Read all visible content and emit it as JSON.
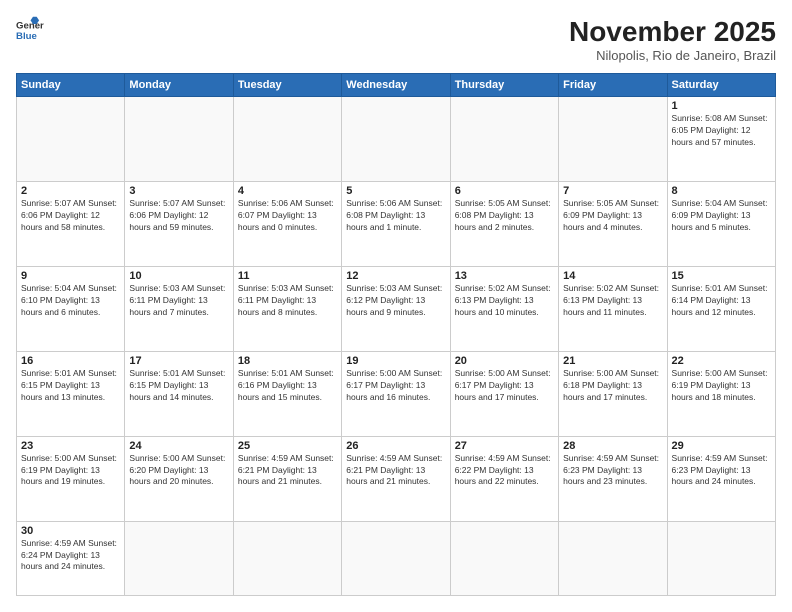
{
  "header": {
    "logo_general": "General",
    "logo_blue": "Blue",
    "month_title": "November 2025",
    "location": "Nilopolis, Rio de Janeiro, Brazil"
  },
  "weekdays": [
    "Sunday",
    "Monday",
    "Tuesday",
    "Wednesday",
    "Thursday",
    "Friday",
    "Saturday"
  ],
  "weeks": [
    [
      {
        "day": null,
        "info": null
      },
      {
        "day": null,
        "info": null
      },
      {
        "day": null,
        "info": null
      },
      {
        "day": null,
        "info": null
      },
      {
        "day": null,
        "info": null
      },
      {
        "day": null,
        "info": null
      },
      {
        "day": "1",
        "info": "Sunrise: 5:08 AM\nSunset: 6:05 PM\nDaylight: 12 hours\nand 57 minutes."
      }
    ],
    [
      {
        "day": "2",
        "info": "Sunrise: 5:07 AM\nSunset: 6:06 PM\nDaylight: 12 hours\nand 58 minutes."
      },
      {
        "day": "3",
        "info": "Sunrise: 5:07 AM\nSunset: 6:06 PM\nDaylight: 12 hours\nand 59 minutes."
      },
      {
        "day": "4",
        "info": "Sunrise: 5:06 AM\nSunset: 6:07 PM\nDaylight: 13 hours\nand 0 minutes."
      },
      {
        "day": "5",
        "info": "Sunrise: 5:06 AM\nSunset: 6:08 PM\nDaylight: 13 hours\nand 1 minute."
      },
      {
        "day": "6",
        "info": "Sunrise: 5:05 AM\nSunset: 6:08 PM\nDaylight: 13 hours\nand 2 minutes."
      },
      {
        "day": "7",
        "info": "Sunrise: 5:05 AM\nSunset: 6:09 PM\nDaylight: 13 hours\nand 4 minutes."
      },
      {
        "day": "8",
        "info": "Sunrise: 5:04 AM\nSunset: 6:09 PM\nDaylight: 13 hours\nand 5 minutes."
      }
    ],
    [
      {
        "day": "9",
        "info": "Sunrise: 5:04 AM\nSunset: 6:10 PM\nDaylight: 13 hours\nand 6 minutes."
      },
      {
        "day": "10",
        "info": "Sunrise: 5:03 AM\nSunset: 6:11 PM\nDaylight: 13 hours\nand 7 minutes."
      },
      {
        "day": "11",
        "info": "Sunrise: 5:03 AM\nSunset: 6:11 PM\nDaylight: 13 hours\nand 8 minutes."
      },
      {
        "day": "12",
        "info": "Sunrise: 5:03 AM\nSunset: 6:12 PM\nDaylight: 13 hours\nand 9 minutes."
      },
      {
        "day": "13",
        "info": "Sunrise: 5:02 AM\nSunset: 6:13 PM\nDaylight: 13 hours\nand 10 minutes."
      },
      {
        "day": "14",
        "info": "Sunrise: 5:02 AM\nSunset: 6:13 PM\nDaylight: 13 hours\nand 11 minutes."
      },
      {
        "day": "15",
        "info": "Sunrise: 5:01 AM\nSunset: 6:14 PM\nDaylight: 13 hours\nand 12 minutes."
      }
    ],
    [
      {
        "day": "16",
        "info": "Sunrise: 5:01 AM\nSunset: 6:15 PM\nDaylight: 13 hours\nand 13 minutes."
      },
      {
        "day": "17",
        "info": "Sunrise: 5:01 AM\nSunset: 6:15 PM\nDaylight: 13 hours\nand 14 minutes."
      },
      {
        "day": "18",
        "info": "Sunrise: 5:01 AM\nSunset: 6:16 PM\nDaylight: 13 hours\nand 15 minutes."
      },
      {
        "day": "19",
        "info": "Sunrise: 5:00 AM\nSunset: 6:17 PM\nDaylight: 13 hours\nand 16 minutes."
      },
      {
        "day": "20",
        "info": "Sunrise: 5:00 AM\nSunset: 6:17 PM\nDaylight: 13 hours\nand 17 minutes."
      },
      {
        "day": "21",
        "info": "Sunrise: 5:00 AM\nSunset: 6:18 PM\nDaylight: 13 hours\nand 17 minutes."
      },
      {
        "day": "22",
        "info": "Sunrise: 5:00 AM\nSunset: 6:19 PM\nDaylight: 13 hours\nand 18 minutes."
      }
    ],
    [
      {
        "day": "23",
        "info": "Sunrise: 5:00 AM\nSunset: 6:19 PM\nDaylight: 13 hours\nand 19 minutes."
      },
      {
        "day": "24",
        "info": "Sunrise: 5:00 AM\nSunset: 6:20 PM\nDaylight: 13 hours\nand 20 minutes."
      },
      {
        "day": "25",
        "info": "Sunrise: 4:59 AM\nSunset: 6:21 PM\nDaylight: 13 hours\nand 21 minutes."
      },
      {
        "day": "26",
        "info": "Sunrise: 4:59 AM\nSunset: 6:21 PM\nDaylight: 13 hours\nand 21 minutes."
      },
      {
        "day": "27",
        "info": "Sunrise: 4:59 AM\nSunset: 6:22 PM\nDaylight: 13 hours\nand 22 minutes."
      },
      {
        "day": "28",
        "info": "Sunrise: 4:59 AM\nSunset: 6:23 PM\nDaylight: 13 hours\nand 23 minutes."
      },
      {
        "day": "29",
        "info": "Sunrise: 4:59 AM\nSunset: 6:23 PM\nDaylight: 13 hours\nand 24 minutes."
      }
    ],
    [
      {
        "day": "30",
        "info": "Sunrise: 4:59 AM\nSunset: 6:24 PM\nDaylight: 13 hours\nand 24 minutes."
      },
      {
        "day": null,
        "info": null
      },
      {
        "day": null,
        "info": null
      },
      {
        "day": null,
        "info": null
      },
      {
        "day": null,
        "info": null
      },
      {
        "day": null,
        "info": null
      },
      {
        "day": null,
        "info": null
      }
    ]
  ]
}
